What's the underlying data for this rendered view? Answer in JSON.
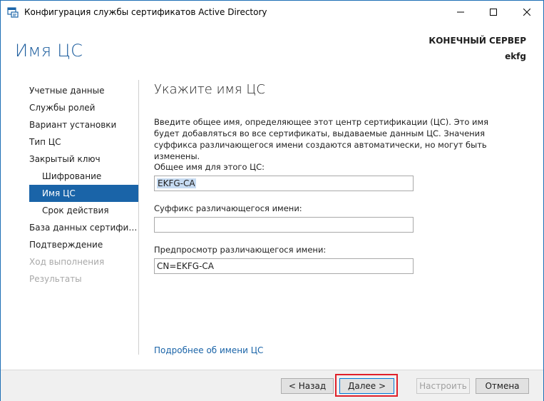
{
  "window": {
    "title": "Конфигурация службы сертификатов Active Directory",
    "minimize_glyph": "—",
    "maximize_glyph": "☐",
    "close_glyph": "✕"
  },
  "header": {
    "heading": "Имя ЦС",
    "destination_label": "КОНЕЧНЫЙ СЕРВЕР",
    "destination_server": "ekfg"
  },
  "nav": {
    "items": [
      {
        "label": "Учетные данные",
        "state": "normal"
      },
      {
        "label": "Службы ролей",
        "state": "normal"
      },
      {
        "label": "Вариант установки",
        "state": "normal"
      },
      {
        "label": "Тип ЦС",
        "state": "normal"
      },
      {
        "label": "Закрытый ключ",
        "state": "normal"
      },
      {
        "label": "Шифрование",
        "state": "sub"
      },
      {
        "label": "Имя ЦС",
        "state": "selected"
      },
      {
        "label": "Срок действия",
        "state": "sub"
      },
      {
        "label": "База данных сертификат...",
        "state": "normal"
      },
      {
        "label": "Подтверждение",
        "state": "normal"
      },
      {
        "label": "Ход выполнения",
        "state": "disabled"
      },
      {
        "label": "Результаты",
        "state": "disabled"
      }
    ]
  },
  "content": {
    "title": "Укажите имя ЦС",
    "description": "Введите общее имя, определяющее этот центр сертификации (ЦС). Это имя будет добавляться во все сертификаты, выдаваемые данным ЦС. Значения суффикса различающегося имени создаются автоматически, но могут быть изменены.",
    "common_name_label": "Общее имя для этого ЦС:",
    "common_name_value": "EKFG-CA",
    "dn_suffix_label": "Суффикс различающегося имени:",
    "dn_suffix_value": "",
    "preview_label": "Предпросмотр различающегося имени:",
    "preview_value": "CN=EKFG-CA",
    "more_link": "Подробнее об имени ЦС"
  },
  "footer": {
    "back": "< Назад",
    "next": "Далее >",
    "configure": "Настроить",
    "cancel": "Отмена"
  },
  "colors": {
    "accent": "#1a64a8",
    "heading": "#1b5c9d",
    "highlight": "#e0202a"
  }
}
